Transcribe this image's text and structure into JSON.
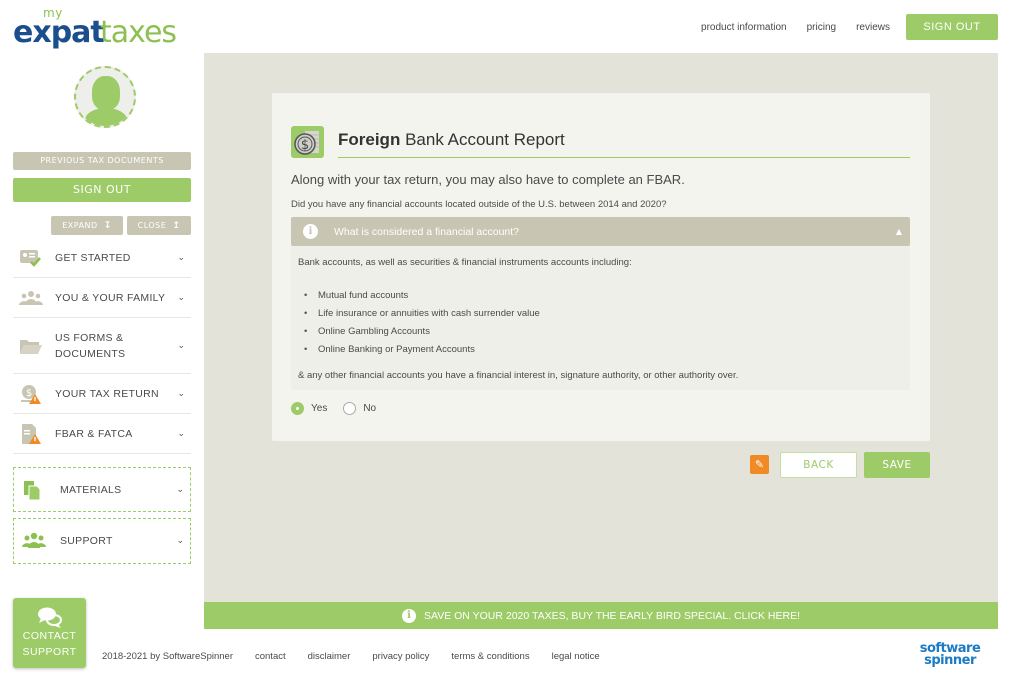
{
  "brand": {
    "logo_my": "my",
    "logo_expat": "expat",
    "logo_taxes": "taxes",
    "colors": {
      "green": "#9dcb68",
      "navy": "#1b4e8c",
      "beige": "#c8c5b3",
      "orange": "#f08a24",
      "panel": "#e4e3da"
    }
  },
  "topnav": {
    "links": [
      "product information",
      "pricing",
      "reviews"
    ],
    "signout_label": "SIGN OUT"
  },
  "sidebar": {
    "avatar_icon": "user-globe-icon",
    "previous_docs_label": "PREVIOUS TAX DOCUMENTS",
    "signout_label": "SIGN OUT",
    "expand_label": "EXPAND",
    "close_label": "CLOSE",
    "items": [
      {
        "label": "GET STARTED",
        "icon": "id-card-check-icon"
      },
      {
        "label": "YOU & YOUR FAMILY",
        "icon": "family-icon"
      },
      {
        "label": "US FORMS & DOCUMENTS",
        "icon": "folder-icon"
      },
      {
        "label": "YOUR TAX RETURN",
        "icon": "money-warning-icon"
      },
      {
        "label": "FBAR & FATCA",
        "icon": "document-warning-icon"
      }
    ],
    "boxed_items": [
      {
        "label": "MATERIALS",
        "icon": "clipboard-icon"
      },
      {
        "label": "SUPPORT",
        "icon": "group-icon"
      }
    ],
    "contact_support": {
      "line1": "CONTACT",
      "line2": "SUPPORT",
      "icon": "chat-bubbles-icon"
    }
  },
  "main": {
    "title_bold": "Foreign",
    "title_rest": " Bank Account Report",
    "title_icon": "dollar-coin-icon",
    "lead": "Along with your tax return, you may also have to complete an FBAR.",
    "question": "Did you have any financial accounts located outside of the U.S. between 2014 and 2020?",
    "accordion": {
      "title": "What is considered a financial account?",
      "intro": "Bank accounts, as well as securities & financial instruments accounts including:",
      "items": [
        "Mutual fund accounts",
        "Life insurance or annuities with cash surrender value",
        "Online Gambling Accounts",
        "Online Banking or Payment Accounts"
      ],
      "outro": "& any other financial accounts you have a financial interest in, signature authority, or other authority over."
    },
    "answer": {
      "options": [
        "Yes",
        "No"
      ],
      "selected": "Yes"
    },
    "back_label": "BACK",
    "save_label": "SAVE",
    "edit_icon": "pencil-icon"
  },
  "promo": {
    "text": "SAVE ON YOUR 2020 TAXES, BUY THE EARLY BIRD SPECIAL. CLICK HERE!"
  },
  "footer": {
    "copyright": "2018-2021 by SoftwareSpinner",
    "links": [
      "contact",
      "disclaimer",
      "privacy policy",
      "terms & conditions",
      "legal notice"
    ],
    "ss_logo_line1": "software",
    "ss_logo_line2": "spinner"
  }
}
